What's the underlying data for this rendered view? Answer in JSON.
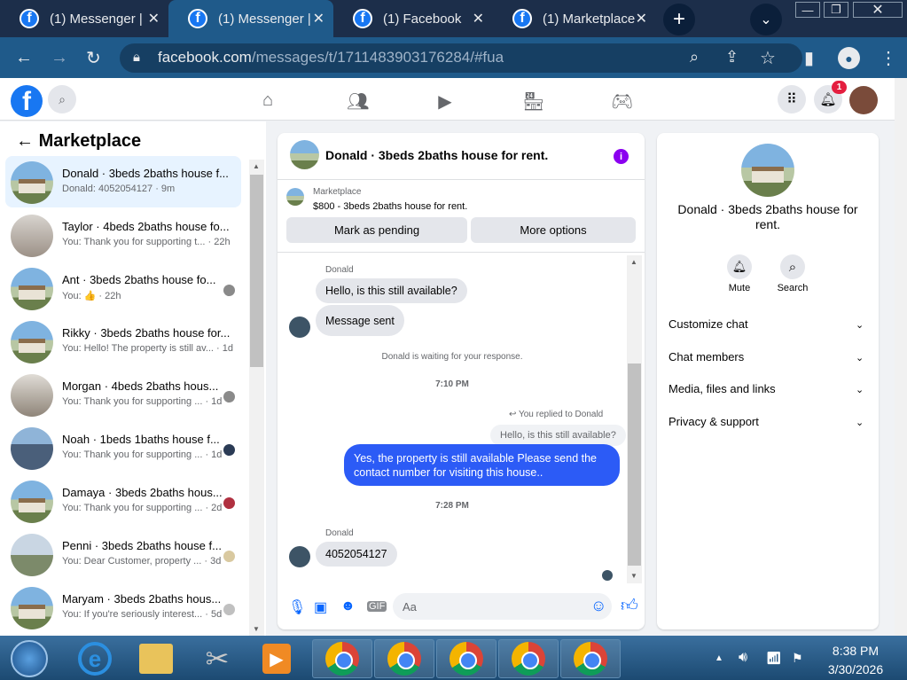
{
  "browser": {
    "tabs": [
      {
        "title": "(1) Messenger |",
        "active": false
      },
      {
        "title": "(1) Messenger |",
        "active": true
      },
      {
        "title": "(1) Facebook",
        "active": false
      },
      {
        "title": "(1) Marketplace",
        "active": false
      }
    ],
    "url_host": "facebook.com",
    "url_path": "/messages/t/1711483903176284/#fua"
  },
  "fb_header": {
    "notification_count": "1"
  },
  "marketplace": {
    "title": "Marketplace",
    "conversations": [
      {
        "name": "Donald · 3beds 2baths house f...",
        "snippet": "Donald: 4052054127 · 9m",
        "selected": true
      },
      {
        "name": "Taylor · 4beds 2baths house fo...",
        "snippet": "You: Thank you for supporting t... · 22h"
      },
      {
        "name": "Ant · 3beds 2baths house fo...",
        "snippet": "You: 👍 · 22h"
      },
      {
        "name": "Rikky · 3beds 2baths house for...",
        "snippet": "You: Hello! The property is still av... · 1d"
      },
      {
        "name": "Morgan · 4beds 2baths hous...",
        "snippet": "You: Thank you for supporting ... · 1d"
      },
      {
        "name": "Noah · 1beds 1baths house f...",
        "snippet": "You: Thank you for supporting ... · 1d"
      },
      {
        "name": "Damaya · 3beds 2baths hous...",
        "snippet": "You: Thank you for supporting ... · 2d"
      },
      {
        "name": "Penni · 3beds 2baths house f...",
        "snippet": "You: Dear Customer, property ... · 3d"
      },
      {
        "name": "Maryam · 3beds 2baths hous...",
        "snippet": "You: If you're seriously interest... · 5d"
      }
    ]
  },
  "chat": {
    "title": "Donald · 3beds 2baths house for rent.",
    "listing_source": "Marketplace",
    "listing_text": "$800 - 3beds 2baths house for rent.",
    "mark_pending_label": "Mark as pending",
    "more_options_label": "More options",
    "messages": {
      "sender1": "Donald",
      "m1": "Hello, is this still available?",
      "m2": "Message sent",
      "waiting": "Donald is waiting for your response.",
      "time1": "7:10 PM",
      "replied_to": "You replied to Donald",
      "quote": "Hello, is this still available?",
      "reply": "Yes, the property is still available Please send the contact number for visiting this house..",
      "time2": "7:28 PM",
      "sender2": "Donald",
      "m3": "4052054127"
    },
    "composer_placeholder": "Aa"
  },
  "profile_panel": {
    "name": "Donald · 3beds 2baths house for rent.",
    "mute_label": "Mute",
    "search_label": "Search",
    "sections": [
      "Customize chat",
      "Chat members",
      "Media, files and links",
      "Privacy & support"
    ]
  },
  "taskbar": {
    "time": "8:38 PM",
    "date": "3/30/2026"
  },
  "colors": {
    "fb_blue": "#1877f2",
    "outgoing_bubble": "#2c5bf6",
    "chrome_frame": "#1f5a8a"
  }
}
